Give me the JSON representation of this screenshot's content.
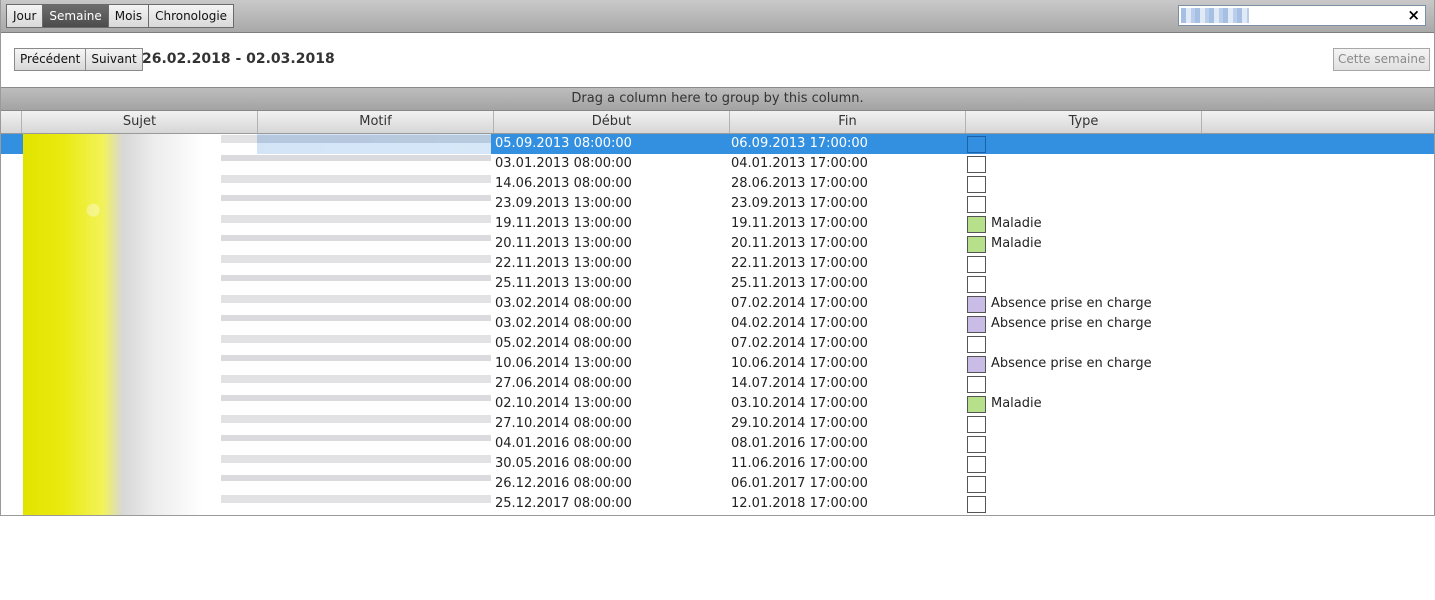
{
  "view_buttons": [
    {
      "label": "Jour",
      "active": false
    },
    {
      "label": "Semaine",
      "active": true
    },
    {
      "label": "Mois",
      "active": false
    },
    {
      "label": "Chronologie",
      "active": false
    }
  ],
  "search": {
    "value": "",
    "clear_icon": "×"
  },
  "nav": {
    "prev_label": "Précédent",
    "next_label": "Suivant",
    "date_range": "26.02.2018 - 02.03.2018",
    "this_week_label": "Cette semaine"
  },
  "group_panel_text": "Drag a column here to group by this column.",
  "columns": [
    "Sujet",
    "Motif",
    "Début",
    "Fin",
    "Type"
  ],
  "colors": {
    "maladie": "#b7e08a",
    "absence": "#c9bde8",
    "selected": "#3390e0"
  },
  "rows": [
    {
      "debut": "05.09.2013 08:00:00",
      "fin": "06.09.2013 17:00:00",
      "type": "",
      "type_key": "none",
      "selected": true
    },
    {
      "debut": "03.01.2013 08:00:00",
      "fin": "04.01.2013 17:00:00",
      "type": "",
      "type_key": "none"
    },
    {
      "debut": "14.06.2013 08:00:00",
      "fin": "28.06.2013 17:00:00",
      "type": "",
      "type_key": "none"
    },
    {
      "debut": "23.09.2013 13:00:00",
      "fin": "23.09.2013 17:00:00",
      "type": "",
      "type_key": "none"
    },
    {
      "debut": "19.11.2013 13:00:00",
      "fin": "19.11.2013 17:00:00",
      "type": "Maladie",
      "type_key": "maladie"
    },
    {
      "debut": "20.11.2013 13:00:00",
      "fin": "20.11.2013 17:00:00",
      "type": "Maladie",
      "type_key": "maladie"
    },
    {
      "debut": "22.11.2013 13:00:00",
      "fin": "22.11.2013 17:00:00",
      "type": "",
      "type_key": "none"
    },
    {
      "debut": "25.11.2013 13:00:00",
      "fin": "25.11.2013 17:00:00",
      "type": "",
      "type_key": "none"
    },
    {
      "debut": "03.02.2014 08:00:00",
      "fin": "07.02.2014 17:00:00",
      "type": "Absence prise en charge",
      "type_key": "absence"
    },
    {
      "debut": "03.02.2014 08:00:00",
      "fin": "04.02.2014 17:00:00",
      "type": "Absence prise en charge",
      "type_key": "absence"
    },
    {
      "debut": "05.02.2014 08:00:00",
      "fin": "07.02.2014 17:00:00",
      "type": "",
      "type_key": "none"
    },
    {
      "debut": "10.06.2014 13:00:00",
      "fin": "10.06.2014 17:00:00",
      "type": "Absence prise en charge",
      "type_key": "absence"
    },
    {
      "debut": "27.06.2014 08:00:00",
      "fin": "14.07.2014 17:00:00",
      "type": "",
      "type_key": "none"
    },
    {
      "debut": "02.10.2014 13:00:00",
      "fin": "03.10.2014 17:00:00",
      "type": "Maladie",
      "type_key": "maladie"
    },
    {
      "debut": "27.10.2014 08:00:00",
      "fin": "29.10.2014 17:00:00",
      "type": "",
      "type_key": "none"
    },
    {
      "debut": "04.01.2016 08:00:00",
      "fin": "08.01.2016 17:00:00",
      "type": "",
      "type_key": "none"
    },
    {
      "debut": "30.05.2016 08:00:00",
      "fin": "11.06.2016 17:00:00",
      "type": "",
      "type_key": "none"
    },
    {
      "debut": "26.12.2016 08:00:00",
      "fin": "06.01.2017 17:00:00",
      "type": "",
      "type_key": "none"
    },
    {
      "debut": "25.12.2017 08:00:00",
      "fin": "12.01.2018 17:00:00",
      "type": "",
      "type_key": "none"
    }
  ]
}
